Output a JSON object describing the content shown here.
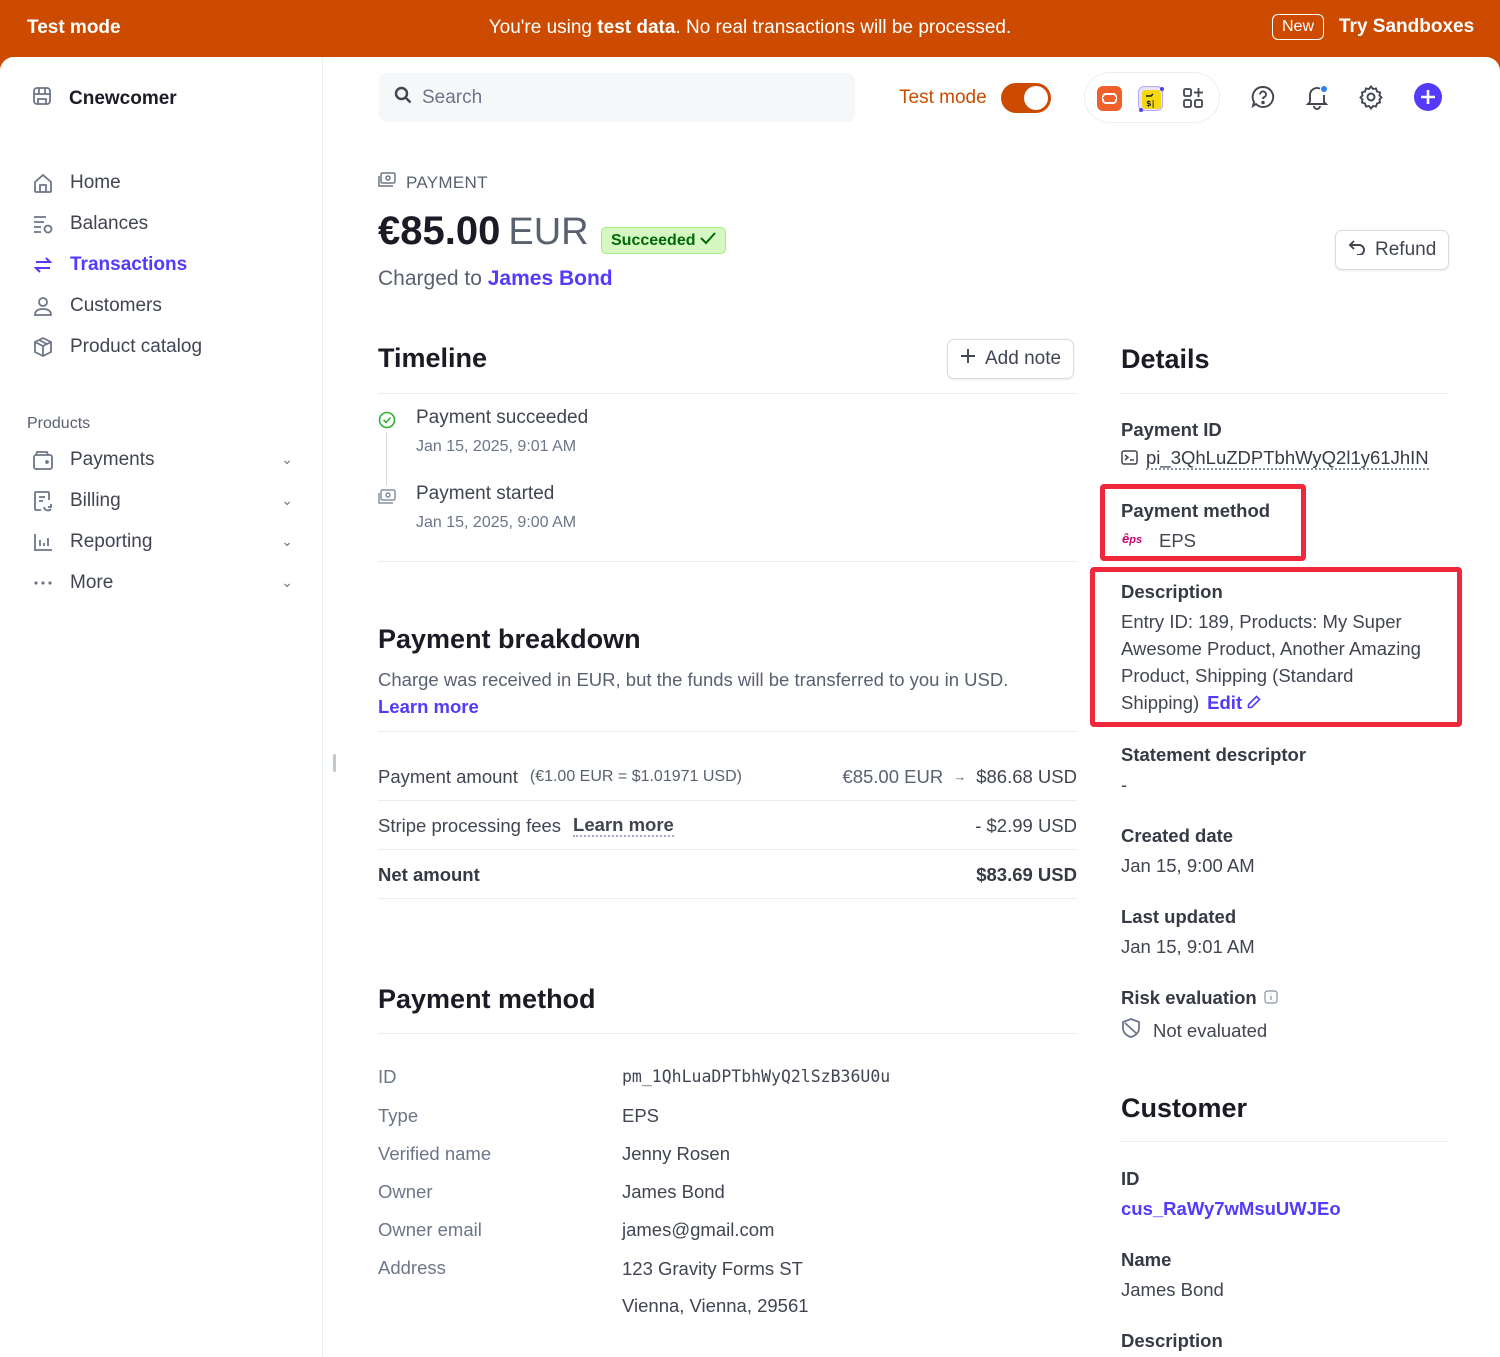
{
  "banner": {
    "mode_label": "Test mode",
    "message_prefix": "You're using ",
    "message_bold": "test data",
    "message_suffix": ". No real transactions will be processed.",
    "new_badge": "New",
    "try_link": "Try Sandboxes",
    "color": "#cc4b00"
  },
  "sidebar": {
    "account_name": "Cnewcomer",
    "items": [
      {
        "label": "Home",
        "icon": "home-icon"
      },
      {
        "label": "Balances",
        "icon": "balances-icon"
      },
      {
        "label": "Transactions",
        "icon": "transactions-icon",
        "active": true
      },
      {
        "label": "Customers",
        "icon": "customer-icon"
      },
      {
        "label": "Product catalog",
        "icon": "box-icon"
      }
    ],
    "section_label": "Products",
    "product_items": [
      {
        "label": "Payments",
        "icon": "wallet-icon"
      },
      {
        "label": "Billing",
        "icon": "billing-icon"
      },
      {
        "label": "Reporting",
        "icon": "chart-icon"
      },
      {
        "label": "More",
        "icon": "more-icon"
      }
    ]
  },
  "header": {
    "search_placeholder": "Search",
    "test_mode_label": "Test mode",
    "test_mode_on": true,
    "accent": "#533afd"
  },
  "payment": {
    "crumb": "PAYMENT",
    "amount": "€85.00",
    "currency": "EUR",
    "status": "Succeeded",
    "charged_prefix": "Charged to",
    "customer_name": "James Bond",
    "refund_label": "Refund"
  },
  "timeline": {
    "title": "Timeline",
    "add_note_label": "Add note",
    "events": [
      {
        "title": "Payment succeeded",
        "date": "Jan 15, 2025, 9:01 AM",
        "icon": "check-circle-icon"
      },
      {
        "title": "Payment started",
        "date": "Jan 15, 2025, 9:00 AM",
        "icon": "payment-icon"
      }
    ]
  },
  "breakdown": {
    "title": "Payment breakdown",
    "description": "Charge was received in EUR, but the funds will be transferred to you in USD.",
    "learn_more": "Learn more",
    "rows": {
      "payment_amount_label": "Payment amount",
      "rate": "(€1.00 EUR = $1.01971 USD)",
      "original": "€85.00 EUR",
      "converted": "$86.68 USD",
      "fees_label": "Stripe processing fees",
      "fees_link": "Learn more",
      "fees_value": "- $2.99 USD",
      "net_label": "Net amount",
      "net_value": "$83.69 USD"
    }
  },
  "payment_method": {
    "title": "Payment method",
    "fields": [
      {
        "label": "ID",
        "value": "pm_1QhLuaDPTbhWyQ2lSzB36U0u"
      },
      {
        "label": "Type",
        "value": "EPS"
      },
      {
        "label": "Verified name",
        "value": "Jenny Rosen"
      },
      {
        "label": "Owner",
        "value": "James Bond"
      },
      {
        "label": "Owner email",
        "value": "james@gmail.com"
      },
      {
        "label": "Address",
        "value": "123 Gravity Forms ST"
      },
      {
        "label": "",
        "value": "Vienna, Vienna, 29561"
      }
    ]
  },
  "details": {
    "title": "Details",
    "payment_id_label": "Payment ID",
    "payment_id": "pi_3QhLuZDPTbhWyQ2l1y61JhIN",
    "payment_method_label": "Payment method",
    "payment_method": "EPS",
    "description_label": "Description",
    "description": "Entry ID: 189, Products: My Super Awesome Product, Another Amazing Product, Shipping (Standard Shipping)",
    "edit_label": "Edit",
    "statement_label": "Statement descriptor",
    "statement_value": "-",
    "created_label": "Created date",
    "created_value": "Jan 15, 9:00 AM",
    "updated_label": "Last updated",
    "updated_value": "Jan 15, 9:01 AM",
    "risk_label": "Risk evaluation",
    "risk_value": "Not evaluated",
    "highlight_color": "#f0283c"
  },
  "customer": {
    "title": "Customer",
    "id_label": "ID",
    "id_value": "cus_RaWy7wMsuUWJEo",
    "name_label": "Name",
    "name_value": "James Bond",
    "description_label": "Description"
  }
}
